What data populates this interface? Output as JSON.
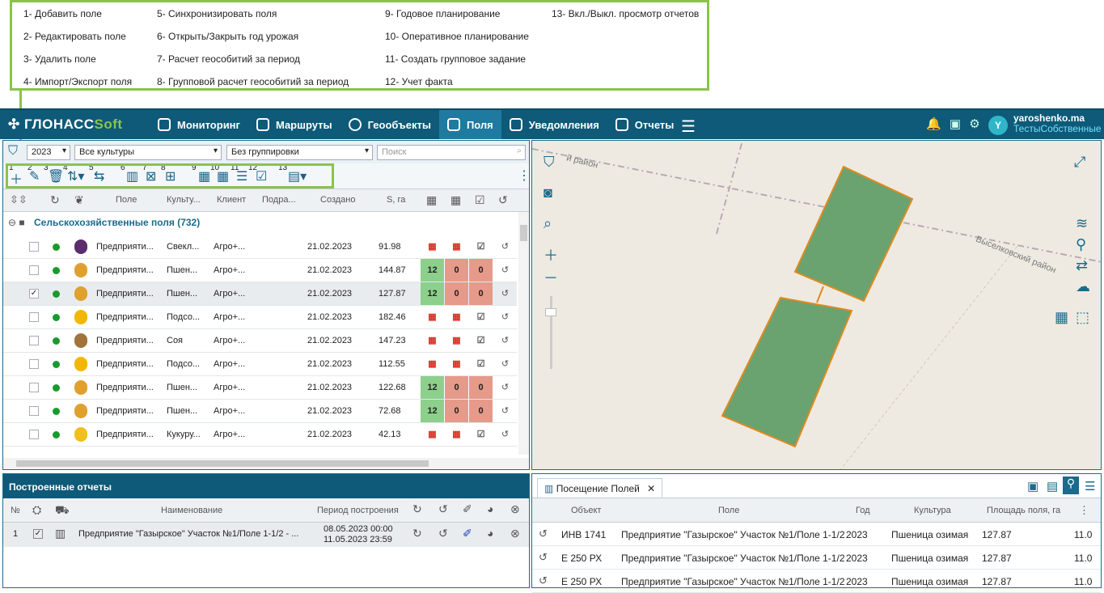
{
  "legend": {
    "col1": [
      "1- Добавить поле",
      "2- Редактировать поле",
      "3- Удалить поле",
      "4- Импорт/Экспорт поля"
    ],
    "col2": [
      "5- Синхронизировать поля",
      "6- Открыть/Закрыть год урожая",
      "7- Расчет геособитий за период",
      "8- Групповой расчет геособитий за период"
    ],
    "col3": [
      "9- Годовое планирование",
      "10- Оперативное планирование",
      "11- Создать групповое задание",
      "12- Учет факта"
    ],
    "col4": [
      "13- Вкл./Выкл. просмотр отчетов"
    ]
  },
  "logo": {
    "part1": "ГЛОНАСС",
    "part2": "Soft"
  },
  "nav": [
    {
      "label": "Мониторинг",
      "icon": "monitor-icon"
    },
    {
      "label": "Маршруты",
      "icon": "bus-icon"
    },
    {
      "label": "Геообъекты",
      "icon": "globe-icon"
    },
    {
      "label": "Поля",
      "icon": "field-icon",
      "active": true
    },
    {
      "label": "Уведомления",
      "icon": "mail-icon"
    },
    {
      "label": "Отчеты",
      "icon": "reports-icon"
    }
  ],
  "user": {
    "avatar": "Y",
    "name": "yaroshenko.ma",
    "company": "ТестыСобственные"
  },
  "filters": {
    "year": "2023",
    "crops": "Все культуры",
    "grouping": "Без группировки",
    "search_placeholder": "Поиск"
  },
  "toolbar_numbers": [
    "1",
    "2",
    "3",
    "4",
    "5",
    "6",
    "7",
    "8",
    "9",
    "10",
    "11",
    "12",
    "13"
  ],
  "columns": {
    "field": "Поле",
    "crop": "Культу...",
    "client": "Клиент",
    "division": "Подра...",
    "created": "Создано",
    "area": "S, га"
  },
  "group": "Сельскохозяйственные поля (732)",
  "rows": [
    {
      "field": "Предприяти...",
      "crop": "Свекл...",
      "client": "Агро+...",
      "created": "21.02.2023",
      "area": "91.98",
      "plan": "",
      "op": "",
      "fact": "",
      "checked": false,
      "cropColor": "#5b2d6e"
    },
    {
      "field": "Предприяти...",
      "crop": "Пшен...",
      "client": "Агро+...",
      "created": "21.02.2023",
      "area": "144.87",
      "plan": "12",
      "op": "0",
      "fact": "0",
      "checked": false,
      "cropColor": "#e0a030"
    },
    {
      "field": "Предприяти...",
      "crop": "Пшен...",
      "client": "Агро+...",
      "created": "21.02.2023",
      "area": "127.87",
      "plan": "12",
      "op": "0",
      "fact": "0",
      "checked": true,
      "cropColor": "#e0a030"
    },
    {
      "field": "Предприяти...",
      "crop": "Подсо...",
      "client": "Агро+...",
      "created": "21.02.2023",
      "area": "182.46",
      "plan": "",
      "op": "",
      "fact": "",
      "checked": false,
      "cropColor": "#f2b705"
    },
    {
      "field": "Предприяти...",
      "crop": "Соя",
      "client": "Агро+...",
      "created": "21.02.2023",
      "area": "147.23",
      "plan": "",
      "op": "",
      "fact": "",
      "checked": false,
      "cropColor": "#a0743a"
    },
    {
      "field": "Предприяти...",
      "crop": "Подсо...",
      "client": "Агро+...",
      "created": "21.02.2023",
      "area": "112.55",
      "plan": "",
      "op": "",
      "fact": "",
      "checked": false,
      "cropColor": "#f2b705"
    },
    {
      "field": "Предприяти...",
      "crop": "Пшен...",
      "client": "Агро+...",
      "created": "21.02.2023",
      "area": "122.68",
      "plan": "12",
      "op": "0",
      "fact": "0",
      "checked": false,
      "cropColor": "#e0a030"
    },
    {
      "field": "Предприяти...",
      "crop": "Пшен...",
      "client": "Агро+...",
      "created": "21.02.2023",
      "area": "72.68",
      "plan": "12",
      "op": "0",
      "fact": "0",
      "checked": false,
      "cropColor": "#e0a030"
    },
    {
      "field": "Предприяти...",
      "crop": "Кукуру...",
      "client": "Агро+...",
      "created": "21.02.2023",
      "area": "42.13",
      "plan": "",
      "op": "",
      "fact": "",
      "checked": false,
      "cropColor": "#f0c020"
    }
  ],
  "map": {
    "district1": "Выселковский район",
    "district2": "й район"
  },
  "reports": {
    "title": "Построенные отчеты",
    "cols": {
      "num": "№",
      "name": "Наименование",
      "period": "Период построения"
    },
    "row": {
      "num": "1",
      "name": "Предприятие \"Газырское\" Участок №1/Поле 1-1/2 - ...",
      "from": "08.05.2023 00:00",
      "to": "11.05.2023 23:59"
    }
  },
  "visits": {
    "tab": "Посещение Полей",
    "cols": {
      "object": "Объект",
      "field": "Поле",
      "year": "Год",
      "crop": "Культура",
      "area": "Площадь поля, га"
    },
    "rows": [
      {
        "object": "ИНВ 1741",
        "field": "Предприятие \"Газырское\" Участок №1/Поле 1-1/2",
        "year": "2023",
        "crop": "Пшеница озимая",
        "area": "127.87",
        "extra": "11.0"
      },
      {
        "object": "Е 250 РХ",
        "field": "Предприятие \"Газырское\" Участок №1/Поле 1-1/2",
        "year": "2023",
        "crop": "Пшеница озимая",
        "area": "127.87",
        "extra": "11.0"
      },
      {
        "object": "Е 250 РХ",
        "field": "Предприятие \"Газырское\" Участок №1/Поле 1-1/2",
        "year": "2023",
        "crop": "Пшеница озимая",
        "area": "127.87",
        "extra": "11.0"
      }
    ]
  }
}
